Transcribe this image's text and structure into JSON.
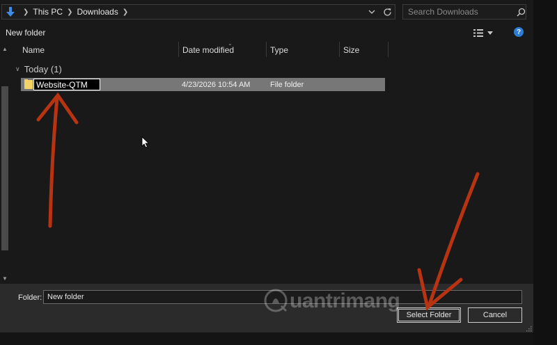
{
  "address": {
    "crumbs": [
      "This PC",
      "Downloads"
    ]
  },
  "search": {
    "placeholder": "Search Downloads"
  },
  "toolbar": {
    "new_folder_label": "New folder",
    "help_label": "?"
  },
  "columns": {
    "name": "Name",
    "date_modified": "Date modified",
    "type": "Type",
    "size": "Size"
  },
  "group": {
    "label": "Today (1)"
  },
  "files": [
    {
      "name": "Website-QTM",
      "date_modified": "4/23/2026 10:54 AM",
      "type": "File folder",
      "size": ""
    }
  ],
  "bottom": {
    "folder_label": "Folder:",
    "folder_value": "New folder",
    "select_label": "Select Folder",
    "cancel_label": "Cancel"
  },
  "watermark": {
    "text": "uantrimang"
  },
  "colors": {
    "selection": "#777777",
    "folder_icon": "#f3d266",
    "annotation_arrow": "#b83312",
    "accent": "#2a7ed8"
  }
}
